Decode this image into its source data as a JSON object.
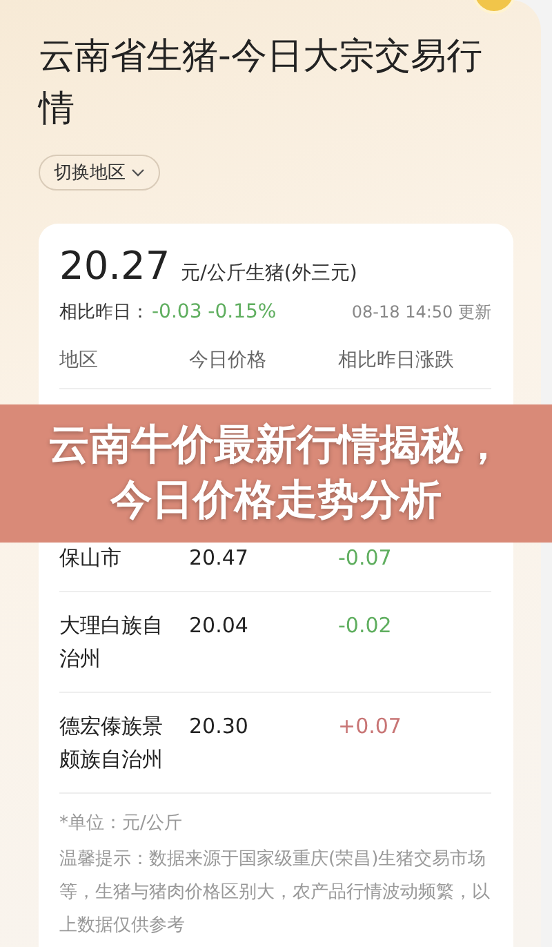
{
  "title": "云南省生猪-今日大宗交易行情",
  "region_button": {
    "label": "切换地区"
  },
  "price": {
    "value": "20.27",
    "unit": "元/公斤生猪(外三元)",
    "compare_label": "相比昨日：",
    "change": "-0.03 -0.15%",
    "color": "#5fae5f",
    "updated": "08-18 14:50 更新"
  },
  "table": {
    "columns": [
      "地区",
      "今日价格",
      "相比昨日涨跌"
    ],
    "rows": [
      {
        "region": "保山市",
        "price": "20.47",
        "change": "-0.07",
        "color": "#5fae5f"
      },
      {
        "region": "大理白族自治州",
        "price": "20.04",
        "change": "-0.02",
        "color": "#5fae5f"
      },
      {
        "region": "德宏傣族景颇族自治州",
        "price": "20.30",
        "change": "+0.07",
        "color": "#c87575"
      }
    ]
  },
  "notes": [
    "*单位：元/公斤",
    "温馨提示：数据来源于国家级重庆(荣昌)生猪交易市场等，生猪与猪肉价格区别大，农产品行情波动频繁，以上数据仅供参考"
  ],
  "banner": {
    "text": "云南牛价最新行情揭秘，今日价格走势分析"
  }
}
